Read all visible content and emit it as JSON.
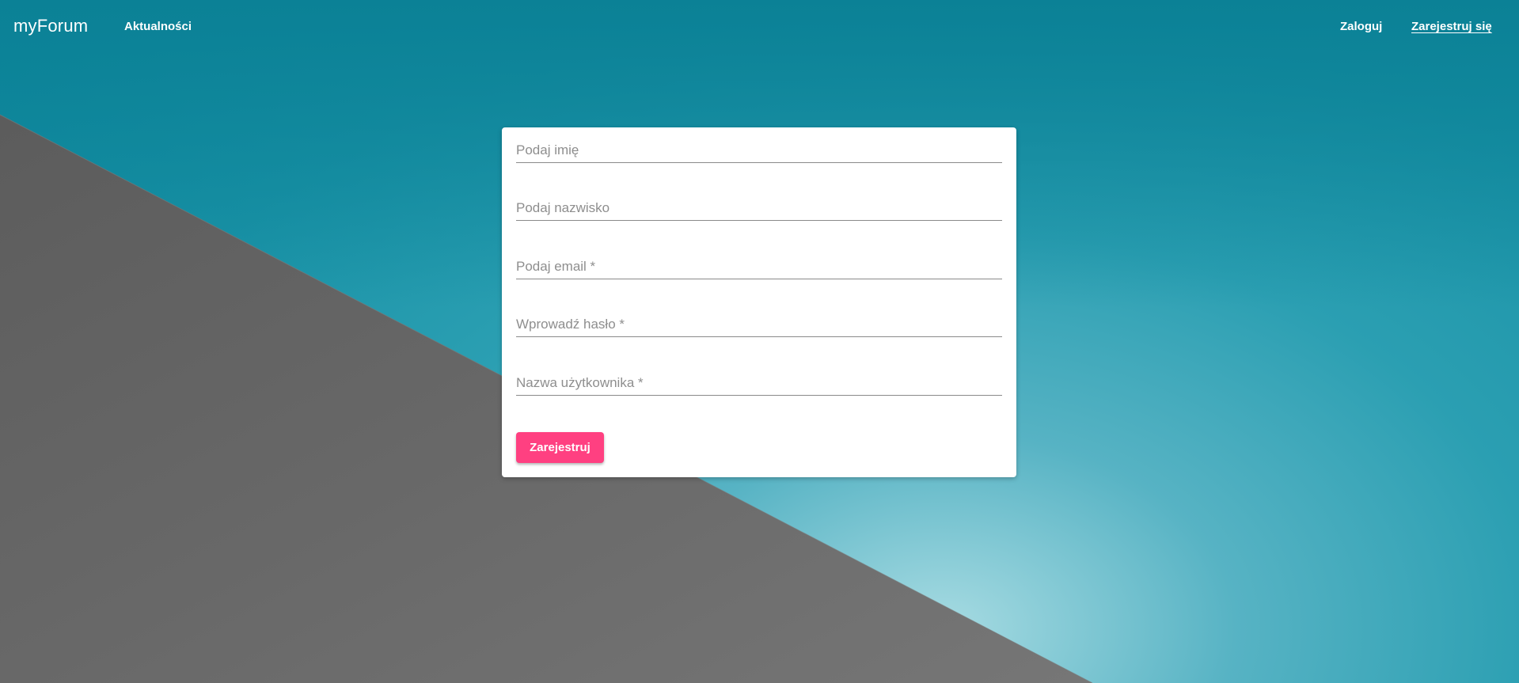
{
  "navbar": {
    "brand": "myForum",
    "news_link": "Aktualności",
    "login_link": "Zaloguj",
    "register_link": "Zarejestruj się"
  },
  "form": {
    "first_name_placeholder": "Podaj imię",
    "last_name_placeholder": "Podaj nazwisko",
    "email_placeholder": "Podaj email *",
    "password_placeholder": "Wprowadź hasło *",
    "username_placeholder": "Nazwa użytkownika *",
    "submit_label": "Zarejestruj"
  },
  "colors": {
    "accent": "#ff4081",
    "sky": "#1a93a7",
    "wall": "#6e6e6e",
    "card": "#ffffff"
  }
}
